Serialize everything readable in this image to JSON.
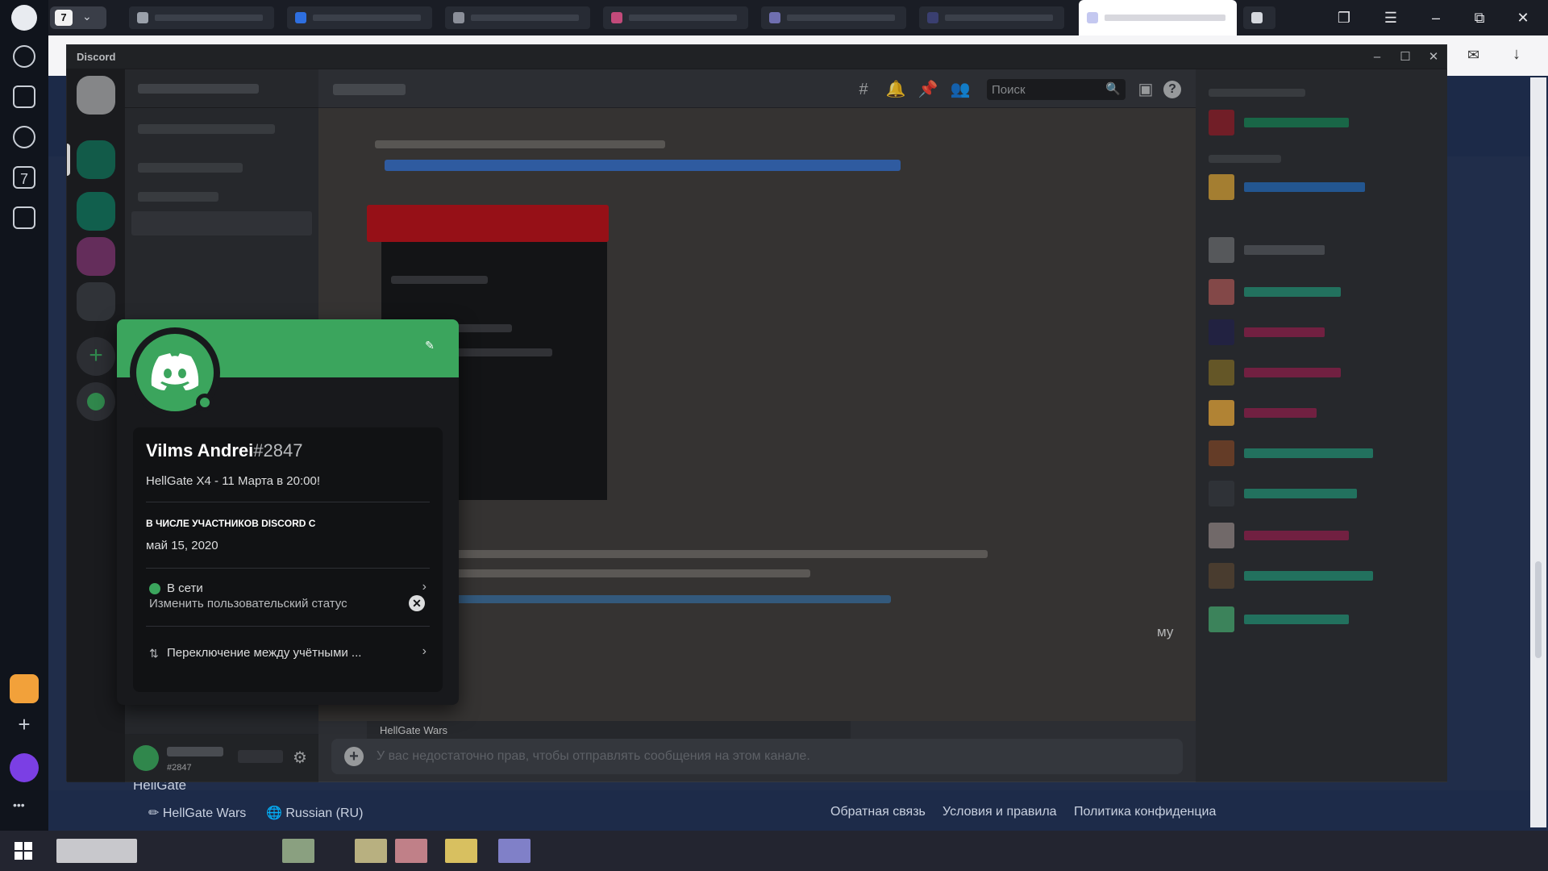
{
  "browser": {
    "tab_counter": "7",
    "sidebar_badge": "7",
    "more_icon": "•••"
  },
  "discord": {
    "window_title": "Discord",
    "search": {
      "placeholder": "Поиск"
    },
    "composer_placeholder": "У вас недостаточно прав, чтобы отправлять сообщения на этом канале.",
    "server_chip": "HellGate Wars",
    "message_tail": "му",
    "user_tag": "#2847",
    "profile": {
      "username": "Vilms Andrei",
      "discriminator": "#2847",
      "bio": "HellGate X4 - 11 Марта в 20:00!",
      "member_since_title": "В ЧИСЛЕ УЧАСТНИКОВ DISCORD С",
      "member_since_date": "май 15, 2020",
      "status_label": "В сети",
      "custom_status_label": "Изменить пользовательский статус",
      "switch_accounts_label": "Переключение между учётными ..."
    }
  },
  "page": {
    "server_name": "HellGate",
    "footer": {
      "server_link": "HellGate Wars",
      "language": "Russian (RU)",
      "feedback": "Обратная связь",
      "terms": "Условия и правила",
      "privacy": "Политика конфиденциа"
    }
  },
  "colors": {
    "discord_green": "#3ba55d",
    "popout_bg": "#18191c",
    "page_bg": "#202d4a"
  }
}
